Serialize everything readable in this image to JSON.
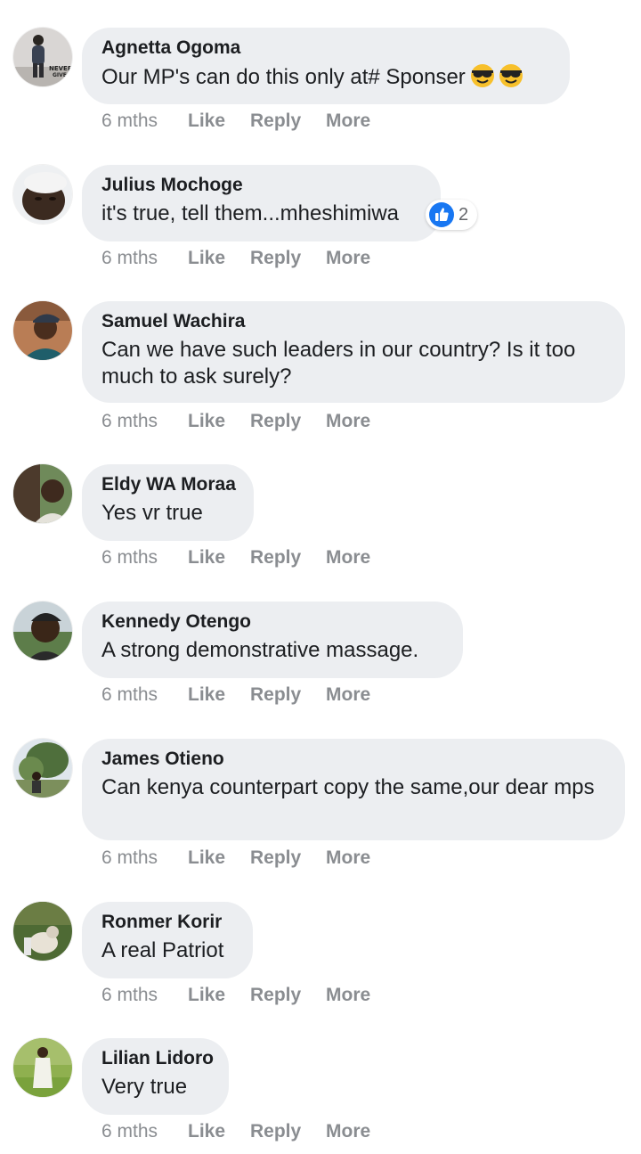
{
  "reaction_color": "#1877f2",
  "comments": [
    {
      "author": "Agnetta Ogoma",
      "text": "Our MP's can do this only at# Sponser",
      "time": "6 mths",
      "like": "Like",
      "reply": "Reply",
      "more": "More",
      "emoji": "smiling-face-with-sunglasses"
    },
    {
      "author": "Julius Mochoge",
      "text": "it's true, tell them...mheshimiwa",
      "time": "6 mths",
      "like": "Like",
      "reply": "Reply",
      "more": "More",
      "reaction_count": "2",
      "reaction_icon": "thumbs-up-icon"
    },
    {
      "author": "Samuel Wachira",
      "text": "Can we have such leaders in our country? Is it too much to ask surely?",
      "time": "6 mths",
      "like": "Like",
      "reply": "Reply",
      "more": "More"
    },
    {
      "author": "Eldy WA Moraa",
      "text": "Yes vr true",
      "time": "6 mths",
      "like": "Like",
      "reply": "Reply",
      "more": "More"
    },
    {
      "author": "Kennedy Otengo",
      "text": "A strong demonstrative massage.",
      "time": "6 mths",
      "like": "Like",
      "reply": "Reply",
      "more": "More"
    },
    {
      "author": "James Otieno",
      "text": "Can kenya counterpart copy the same,our dear mps",
      "time": "6 mths",
      "like": "Like",
      "reply": "Reply",
      "more": "More"
    },
    {
      "author": "Ronmer Korir",
      "text": "A real Patriot",
      "time": "6 mths",
      "like": "Like",
      "reply": "Reply",
      "more": "More"
    },
    {
      "author": "Lilian Lidoro",
      "text": "Very true",
      "time": "6 mths",
      "like": "Like",
      "reply": "Reply",
      "more": "More"
    }
  ]
}
